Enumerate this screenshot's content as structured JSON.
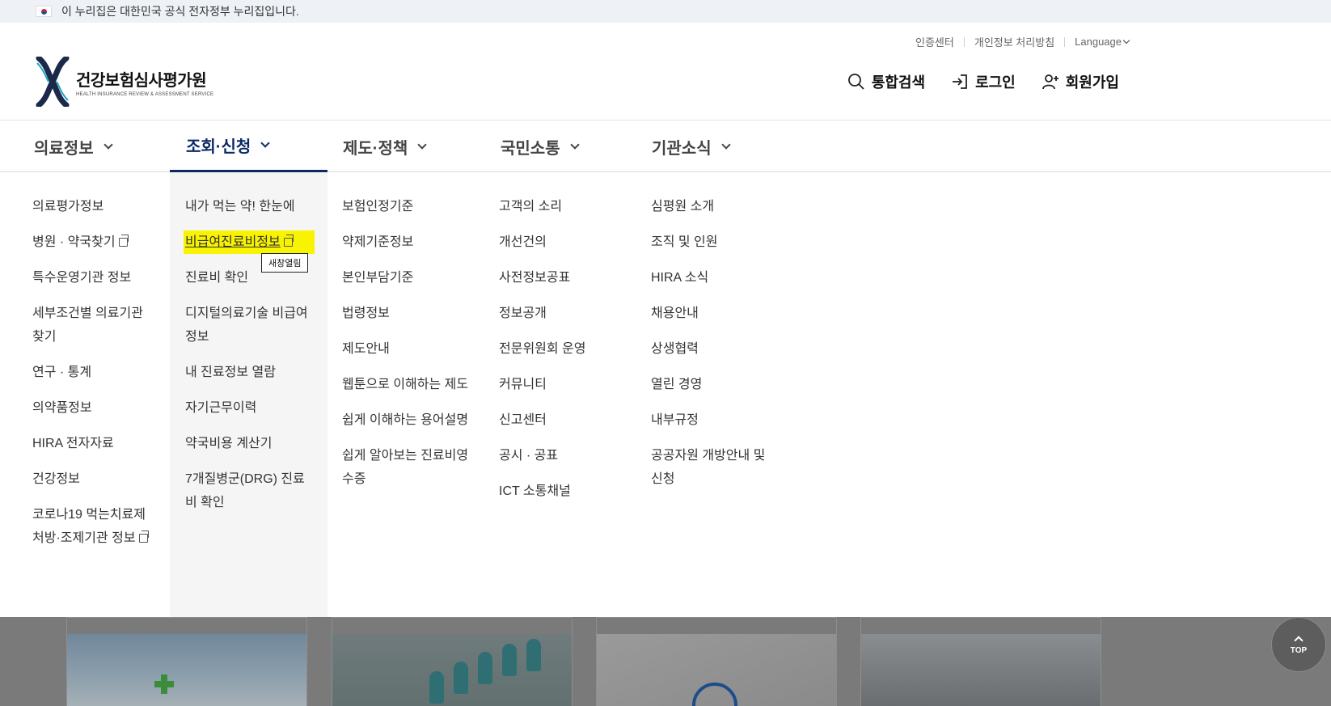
{
  "gov_banner": {
    "text": "이 누리집은 대한민국 공식 전자정부 누리집입니다."
  },
  "header": {
    "logo_ko": "건강보험심사평가원",
    "logo_en": "HEALTH INSURANCE REVIEW & ASSESSMENT SERVICE",
    "util": {
      "cert": "인증센터",
      "privacy": "개인정보 처리방침",
      "language": "Language"
    },
    "actions": {
      "search": "통합검색",
      "login": "로그인",
      "signup": "회원가입"
    }
  },
  "nav": {
    "items": [
      {
        "label": "의료정보"
      },
      {
        "label": "조회·신청"
      },
      {
        "label": "제도·정책"
      },
      {
        "label": "국민소통"
      },
      {
        "label": "기관소식"
      }
    ]
  },
  "menu": {
    "col1": [
      "의료평가정보",
      "병원 · 약국찾기",
      "특수운영기관 정보",
      "세부조건별 의료기관 찾기",
      "연구 · 통계",
      "의약품정보",
      "HIRA 전자자료",
      "건강정보",
      "코로나19 먹는치료제 처방·조제기관 정보"
    ],
    "col2": [
      "내가 먹는 약! 한눈에",
      "비급여진료비정보",
      "진료비 확인",
      "디지털의료기술 비급여정보",
      "내 진료정보 열람",
      "자기근무이력",
      "약국비용 계산기",
      "7개질병군(DRG) 진료비 확인"
    ],
    "col3": [
      "보험인정기준",
      "약제기준정보",
      "본인부담기준",
      "법령정보",
      "제도안내",
      "웹툰으로 이해하는 제도",
      "쉽게 이해하는 용어설명",
      "쉽게 알아보는 진료비영수증"
    ],
    "col4": [
      "고객의 소리",
      "개선건의",
      "사전정보공표",
      "정보공개",
      "전문위원회 운영",
      "커뮤니티",
      "신고센터",
      "공시 · 공표",
      "ICT 소통채널"
    ],
    "col5": [
      "심평원 소개",
      "조직 및 인원",
      "HIRA 소식",
      "채용안내",
      "상생협력",
      "열린 경영",
      "내부규정",
      "공공자원 개방안내 및 신청"
    ]
  },
  "tooltip": "새창열림",
  "top_button": "TOP",
  "colors": {
    "brand_navy": "#0b2a63",
    "highlight": "#f8f300"
  },
  "icons": [
    "search-icon",
    "login-icon",
    "signup-icon",
    "external-link-icon",
    "chevron-down-icon",
    "arrow-up-icon"
  ]
}
